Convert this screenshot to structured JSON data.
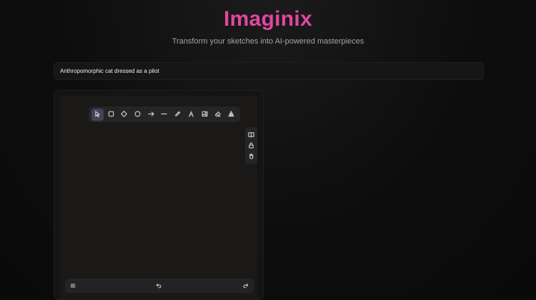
{
  "header": {
    "title": "Imaginix",
    "subtitle": "Transform your sketches into AI-powered masterpieces"
  },
  "prompt": {
    "value": "Anthropomorphic cat dressed as a pilot"
  },
  "canvas": {
    "toolbar": {
      "tools": [
        {
          "name": "selection",
          "icon": "selection-tool-icon",
          "active": true
        },
        {
          "name": "rectangle",
          "icon": "rectangle-tool-icon",
          "active": false
        },
        {
          "name": "diamond",
          "icon": "diamond-tool-icon",
          "active": false
        },
        {
          "name": "ellipse",
          "icon": "ellipse-tool-icon",
          "active": false
        },
        {
          "name": "arrow",
          "icon": "arrow-tool-icon",
          "active": false
        },
        {
          "name": "line",
          "icon": "line-tool-icon",
          "active": false
        },
        {
          "name": "draw",
          "icon": "pencil-tool-icon",
          "active": false
        },
        {
          "name": "text",
          "icon": "text-tool-icon",
          "active": false
        },
        {
          "name": "image",
          "icon": "image-tool-icon",
          "active": false
        },
        {
          "name": "eraser",
          "icon": "eraser-tool-icon",
          "active": false
        },
        {
          "name": "more-tools",
          "icon": "shapes-tool-icon",
          "active": false
        }
      ]
    },
    "side_toolbar": {
      "items": [
        "library-icon",
        "lock-icon",
        "hand-icon"
      ]
    },
    "bottom_bar": {
      "items": [
        "menu-icon",
        "undo-icon",
        "redo-icon"
      ]
    }
  },
  "colors": {
    "accent": "#e0479e",
    "background": "#0d0d0d",
    "canvas": "#1b1917",
    "toolbar": "#252527",
    "active_tool": "#43435a"
  }
}
